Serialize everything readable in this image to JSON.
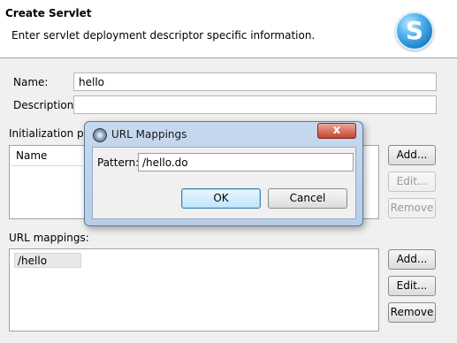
{
  "header": {
    "title": "Create Servlet",
    "description": "Enter servlet deployment descriptor specific information.",
    "logo_letter": "S"
  },
  "form": {
    "name_label": "Name:",
    "name_value": "hello",
    "description_label": "Description:",
    "description_value": "",
    "init_params_label": "Initialization par",
    "init_params_table": {
      "columns": [
        "Name"
      ]
    },
    "init_params_buttons": {
      "add": "Add...",
      "edit": "Edit...",
      "remove": "Remove"
    },
    "url_mappings_label": "URL mappings:",
    "url_mappings_items": [
      "/hello"
    ],
    "url_mappings_buttons": {
      "add": "Add...",
      "edit": "Edit...",
      "remove": "Remove"
    }
  },
  "dialog": {
    "title": "URL Mappings",
    "pattern_label": "Pattern:",
    "pattern_value": "/hello.do",
    "ok_label": "OK",
    "cancel_label": "Cancel",
    "close_glyph": "x"
  },
  "colors": {
    "accent": "#1f7fc8",
    "dialog_frame": "#b7cde7",
    "close_button": "#c7432f"
  }
}
